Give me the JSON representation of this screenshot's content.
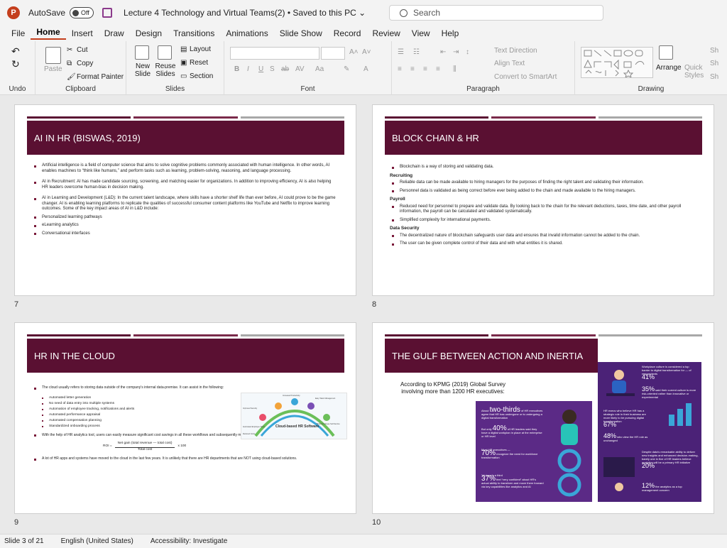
{
  "titlebar": {
    "autosave_label": "AutoSave",
    "autosave_state": "Off",
    "doc_title": "Lecture 4 Technology and Virtual Teams(2) • Saved to this PC ⌄",
    "search_placeholder": "Search"
  },
  "menu": {
    "items": [
      "File",
      "Home",
      "Insert",
      "Draw",
      "Design",
      "Transitions",
      "Animations",
      "Slide Show",
      "Record",
      "Review",
      "View",
      "Help"
    ],
    "active": "Home"
  },
  "ribbon": {
    "undo": {
      "label": "Undo"
    },
    "clipboard": {
      "label": "Clipboard",
      "paste": "Paste",
      "cut": "Cut",
      "copy": "Copy",
      "format_painter": "Format Painter"
    },
    "slides": {
      "label": "Slides",
      "new_slide": "New Slide",
      "reuse_slides": "Reuse Slides",
      "layout": "Layout",
      "reset": "Reset",
      "section": "Section"
    },
    "font": {
      "label": "Font"
    },
    "paragraph": {
      "label": "Paragraph",
      "text_direction": "Text Direction",
      "align_text": "Align Text",
      "convert_smartart": "Convert to SmartArt"
    },
    "drawing": {
      "label": "Drawing",
      "arrange": "Arrange",
      "quick_styles": "Quick Styles",
      "sh1": "Sh",
      "sh2": "Sh",
      "sh3": "Sh"
    }
  },
  "slides": [
    {
      "number": "7",
      "title": "AI IN HR (BISWAS, 2019)",
      "bullets": [
        "Artificial intelligence is a field of computer science that aims to solve cognitive problems commonly associated with human intelligence. In other words, AI enables machines to “think like humans,” and perform tasks such as learning, problem-solving, reasoning, and language processing.",
        "AI in Recruitment: AI has made candidate sourcing, screening, and matching easier for organizations. In addition to improving efficiency, AI is also helping HR leaders overcome human-bias in decision making.",
        "AI in Learning and Development (L&D): In the current talent landscape, where skills have a shorter shelf life than ever before, AI could prove to be the game changer. AI is enabling learning platforms to replicate the qualities of successful consumer content platforms like YouTube and Netflix to improve learning outcomes. Some of the key impact areas of AI in L&D include:",
        "Personalized learning pathways",
        "eLearning analytics",
        "Conversational interfaces"
      ]
    },
    {
      "number": "8",
      "title": "BLOCK CHAIN & HR",
      "intro": "Blockchain is a way of storing and validating data.",
      "sections": [
        {
          "heading": "Recruiting",
          "items": [
            "Reliable data can be made available to hiring managers for the purposes of finding the right talent and validating their information.",
            "Personnel data is validated as being correct before ever being added to the chain and made available to the hiring managers."
          ]
        },
        {
          "heading": "Payroll",
          "items": [
            "Reduced need for personnel to prepare and validate data. By looking back to the chain for the relevant deductions, taxes, time date, and other payroll information, the payroll can be calculated and validated systematically.",
            "Simplified complexity for international payments."
          ]
        },
        {
          "heading": "Data Security",
          "items": [
            "The decentralized nature of blockchain safeguards user data and ensures that invalid information cannot be added to the chain.",
            "The user can be given complete control of their data and with what entities it is shared."
          ]
        }
      ]
    },
    {
      "number": "9",
      "title": "HR IN THE CLOUD",
      "intro": "The cloud usually refers to storing data outside of the company's internal data-premise. It can assist in the following:",
      "sub_items": [
        "Automated letter generation",
        "No need of data entry into multiple systems",
        "Automation of employee tracking, notifications and alerts",
        "Automated performance appraisal",
        "Automated compensation planning",
        "Standardized onboarding process"
      ],
      "roi_text": "With the help of HR analytics tool, users can easily measure significant cost savings in all these workflows and subsequently measure ROI.",
      "roi_formula": {
        "lhs": "ROI =",
        "numerator": "Net gain (total revenue — total cost)",
        "denominator": "Total cost",
        "multiplier": "x 100"
      },
      "closing": "A lot of HR apps and systems have moved to the cloud in the last few years. It is unlikely that there are HR departments that are NOT using cloud-based solutions.",
      "diagram": {
        "center": "Cloud-based HR Software",
        "labels": [
          "Improved Security",
          "Increased Productivity",
          "Easy Talent Management",
          "Better Employee Self-Service",
          "Automated Employee Tasks",
          "Reduced Costs"
        ]
      }
    },
    {
      "number": "10",
      "title": "THE GULF BETWEEN ACTION AND INERTIA",
      "survey_text": "According to KPMG (2019) Global Survey involving more than 1200 HR executives:",
      "left_panel": [
        {
          "big": "two-thirds",
          "prefix": "About",
          "text": "of HR executives agree that HR has undergone or is undergoing a digital transformation"
        },
        {
          "big": "40%",
          "prefix": "But only",
          "text": "of HR leaders said they have a digital workplan in place at the enterprise or HR level"
        },
        {
          "big": "70%",
          "prefix": "Most HR executives —",
          "text": "recognize the need for workforce transformation"
        },
        {
          "big": "37%",
          "prefix": "Yet barely a third",
          "text": "feel “very confident” about HR's actual ability to transform and move them forward via key capabilities like analytics and AI"
        }
      ],
      "right_panel": [
        {
          "big": "41%",
          "text": "Workplace culture is considered a top barrier to digital transformation for — of respondents"
        },
        {
          "big": "35%",
          "text": "said their current culture is more risk-oriented rather than innovative or experimental"
        },
        {
          "big": "67%",
          "text": "HR execs who believe HR has a strategic role in their business are more likely to be pursuing digital transformation"
        },
        {
          "big": "48%",
          "text": "who view the HR role as unchanged"
        },
        {
          "big": "20%",
          "text": "Despite data's remarkable ability to deliver new insights and enhanced decision-making, barely one in five of HR leaders believe analytics will be a primary HR initiative"
        },
        {
          "big": "12%",
          "text": "the analytics as a top management concern"
        }
      ]
    }
  ],
  "status": {
    "slide": "Slide 3 of 21",
    "language": "English (United States)",
    "accessibility": "Accessibility: Investigate"
  },
  "colors": {
    "banner": "#5a1032",
    "accent": "#c43e1c",
    "infographic": "#5b2a86"
  }
}
